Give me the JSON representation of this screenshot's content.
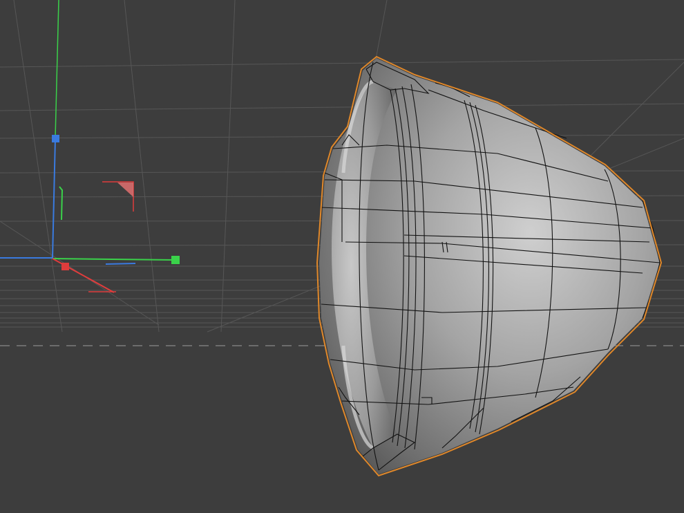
{
  "viewport": {
    "kind": "3d-perspective-view",
    "background": "#3d3d3d",
    "grid_color": "#565656",
    "horizon_dash_color": "#8a8a8a"
  },
  "gizmo": {
    "x_axis_color": "#e03c3c",
    "y_axis_color": "#3ad24a",
    "z_axis_color": "#3a7be0",
    "handles": [
      "x-handle",
      "y-handle",
      "z-handle"
    ],
    "plane_handles": [
      "xz-plane-handle",
      "xy-plane-handle"
    ]
  },
  "selected_object": {
    "shape": "hollow-bell-shell",
    "surface_color": "#9a9a9a",
    "wireframe_color": "#111111",
    "selection_outline_color": "#e0882a"
  }
}
